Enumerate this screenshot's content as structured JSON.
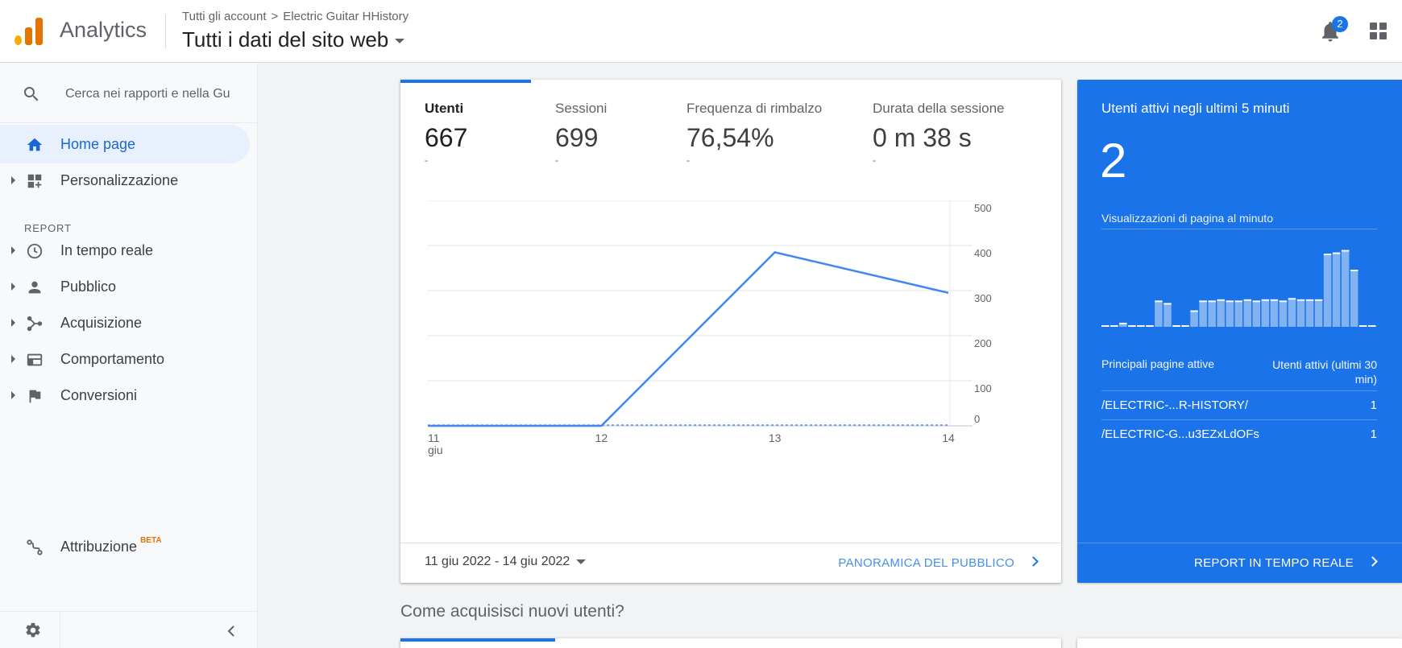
{
  "header": {
    "app_name": "Analytics",
    "breadcrumb": [
      "Tutti gli account",
      "Electric Guitar HHistory"
    ],
    "breadcrumb_sep": ">",
    "view_title": "Tutti i dati del sito web",
    "notification_count": "2",
    "icons": [
      "analytics-logo",
      "bell-icon",
      "apps-grid-icon",
      "dropdown-caret-icon"
    ]
  },
  "sidebar": {
    "search_placeholder": "Cerca nei rapporti e nella Gu",
    "home": "Home page",
    "customization": "Personalizzazione",
    "section_label": "REPORT",
    "items": [
      {
        "label": "In tempo reale",
        "icon": "clock-icon"
      },
      {
        "label": "Pubblico",
        "icon": "person-icon"
      },
      {
        "label": "Acquisizione",
        "icon": "acquisition-icon"
      },
      {
        "label": "Comportamento",
        "icon": "behavior-icon"
      },
      {
        "label": "Conversioni",
        "icon": "flag-icon"
      }
    ],
    "attribution": "Attribuzione",
    "attribution_badge": "BETA"
  },
  "overview": {
    "metrics": [
      {
        "label": "Utenti",
        "value": "667",
        "delta": "-"
      },
      {
        "label": "Sessioni",
        "value": "699",
        "delta": "-"
      },
      {
        "label": "Frequenza di rimbalzo",
        "value": "76,54%",
        "delta": "-"
      },
      {
        "label": "Durata della sessione",
        "value": "0 m 38 s",
        "delta": "-"
      }
    ],
    "date_range": "11 giu 2022 - 14 giu 2022",
    "footer_link": "PANORAMICA DEL PUBBLICO"
  },
  "chart_data": {
    "type": "line",
    "categories": [
      "11 giu",
      "12",
      "13",
      "14"
    ],
    "x_tick_labels": [
      "11",
      "12",
      "13",
      "14"
    ],
    "x_first_sublabel": "giu",
    "values": [
      0,
      0,
      385,
      295
    ],
    "y_ticks": [
      0,
      100,
      200,
      300,
      400,
      500
    ],
    "ylim": [
      0,
      500
    ],
    "grid": true,
    "color": "#4285f4",
    "comparison_line": "dashed at 0"
  },
  "realtime": {
    "title": "Utenti attivi negli ultimi 5 minuti",
    "active_users": "2",
    "subtitle": "Visualizzazioni di pagina al minuto",
    "pageviews_per_minute": [
      0,
      0,
      0.1,
      0,
      0,
      0,
      1,
      0.9,
      0,
      0,
      0.6,
      1,
      1,
      1.05,
      1,
      1,
      1.05,
      1,
      1.05,
      1.05,
      1,
      1.1,
      1.05,
      1.05,
      1.05,
      2.9,
      2.95,
      3.05,
      2.25,
      0,
      0
    ],
    "table_head_left": "Principali pagine attive",
    "table_head_right": "Utenti attivi (ultimi 30 min)",
    "rows": [
      {
        "page": "/ELECTRIC-...R-HISTORY/",
        "users": "1"
      },
      {
        "page": "/ELECTRIC-G...u3EZxLdOFs",
        "users": "1"
      }
    ],
    "footer_link": "REPORT IN TEMPO REALE",
    "color": "#1a73e8"
  },
  "acquisition": {
    "heading": "Come acquisisci nuovi utenti?"
  }
}
